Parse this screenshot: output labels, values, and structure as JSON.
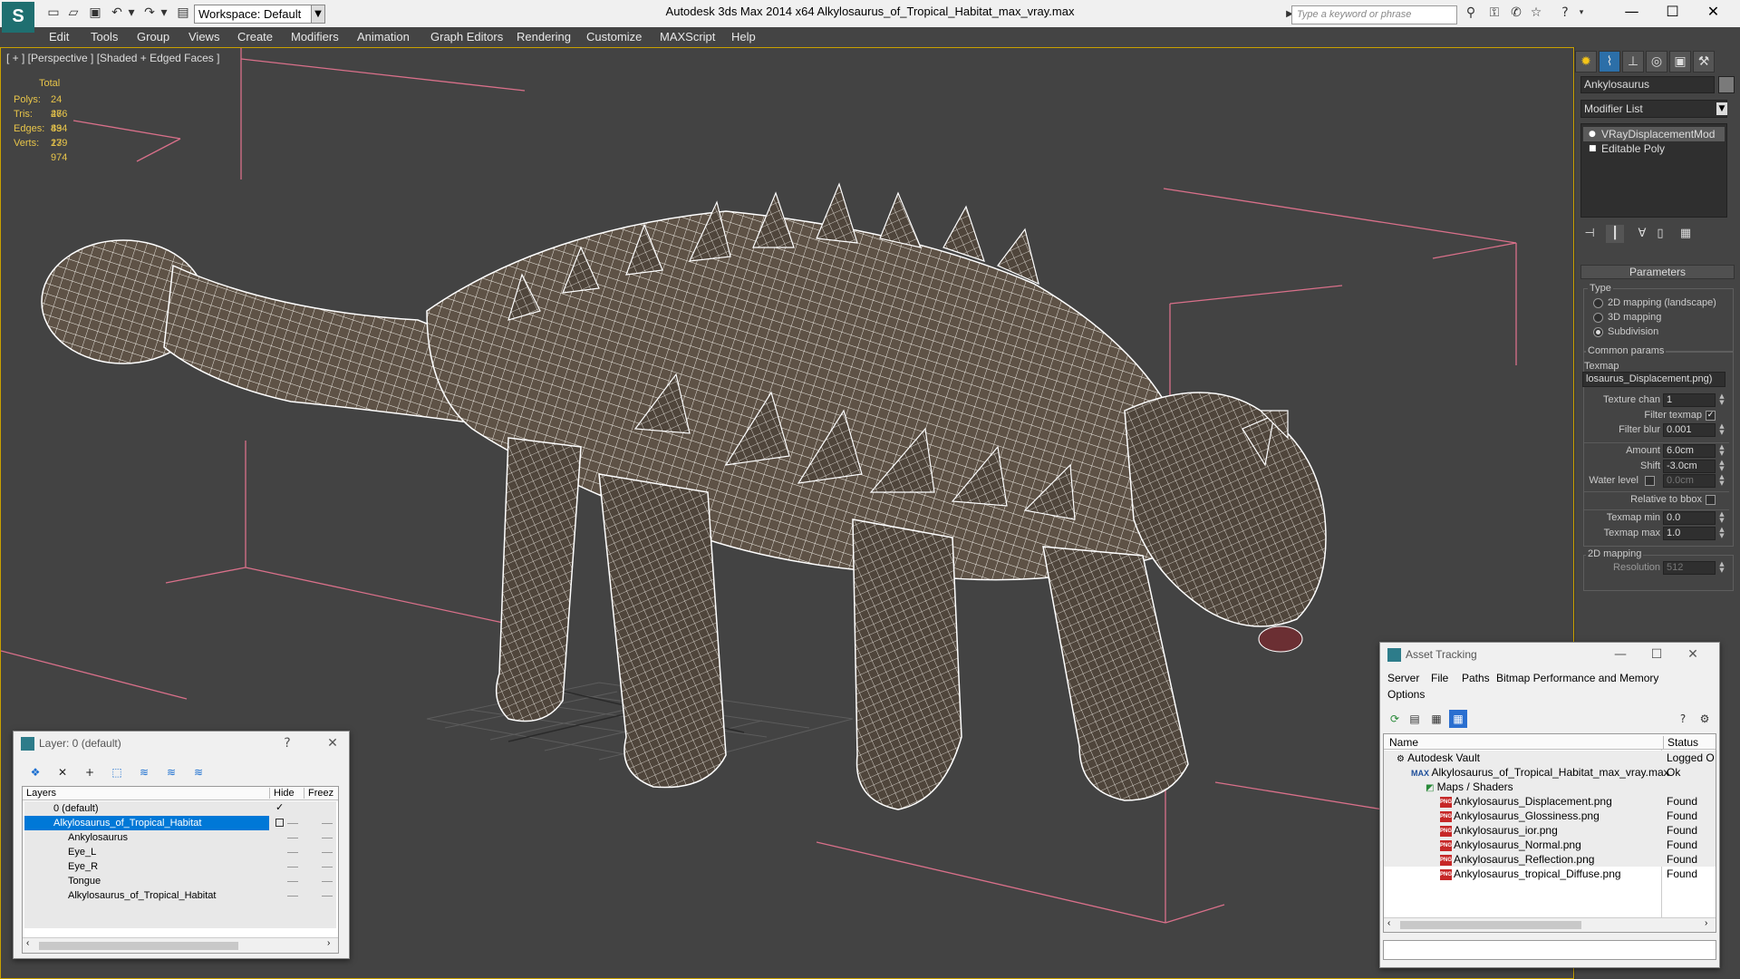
{
  "window": {
    "title": "Autodesk 3ds Max 2014 x64      Alkylosaurus_of_Tropical_Habitat_max_vray.max",
    "workspace": "Workspace: Default",
    "search_placeholder": "Type a keyword or phrase"
  },
  "menu": [
    "Edit",
    "Tools",
    "Group",
    "Views",
    "Create",
    "Modifiers",
    "Animation",
    "Graph Editors",
    "Rendering",
    "Customize",
    "MAXScript",
    "Help"
  ],
  "viewport": {
    "label": "[ + ] [Perspective ] [Shaded + Edged Faces ]",
    "stats_header": "Total",
    "stats": [
      {
        "label": "Polys:",
        "value": "24 266"
      },
      {
        "label": "Tris:",
        "value": "47 834"
      },
      {
        "label": "Edges:",
        "value": "49 179"
      },
      {
        "label": "Verts:",
        "value": "23 974"
      }
    ]
  },
  "command_panel": {
    "object_name": "Ankylosaurus",
    "modifier_list": "Modifier List",
    "stack": [
      "VRayDisplacementMod",
      "Editable Poly"
    ],
    "parameters": {
      "header": "Parameters",
      "type_label": "Type",
      "type_options": [
        "2D mapping (landscape)",
        "3D mapping",
        "Subdivision"
      ],
      "type_selected": 2,
      "common_label": "Common params",
      "texmap_label": "Texmap",
      "texmap_value": "losaurus_Displacement.png)",
      "texture_chan_label": "Texture chan",
      "texture_chan_value": "1",
      "filter_texmap_label": "Filter texmap",
      "filter_blur_label": "Filter blur",
      "filter_blur_value": "0.001",
      "amount_label": "Amount",
      "amount_value": "6.0cm",
      "shift_label": "Shift",
      "shift_value": "-3.0cm",
      "water_label": "Water level",
      "water_value": "0.0cm",
      "relative_label": "Relative to bbox",
      "texmap_min_label": "Texmap min",
      "texmap_min_value": "0.0",
      "texmap_max_label": "Texmap max",
      "texmap_max_value": "1.0",
      "mapping2d_label": "2D mapping",
      "resolution_label": "Resolution",
      "resolution_value": "512"
    }
  },
  "layer_window": {
    "title": "Layer: 0 (default)",
    "help": "?",
    "columns": [
      "Layers",
      "Hide",
      "Freez"
    ],
    "rows": [
      {
        "name": "0 (default)",
        "indent": 1
      },
      {
        "name": "Alkylosaurus_of_Tropical_Habitat",
        "indent": 1
      },
      {
        "name": "Ankylosaurus",
        "indent": 2
      },
      {
        "name": "Eye_L",
        "indent": 2
      },
      {
        "name": "Eye_R",
        "indent": 2
      },
      {
        "name": "Tongue",
        "indent": 2
      },
      {
        "name": "Alkylosaurus_of_Tropical_Habitat",
        "indent": 2
      }
    ]
  },
  "asset_window": {
    "title": "Asset Tracking",
    "menu": [
      "Server",
      "File",
      "Paths",
      "Bitmap Performance and Memory",
      "Options"
    ],
    "columns": [
      "Name",
      "Status"
    ],
    "rows": [
      {
        "name": "Autodesk Vault",
        "status": "Logged O",
        "indent": 0
      },
      {
        "name": "Alkylosaurus_of_Tropical_Habitat_max_vray.max",
        "status": "Ok",
        "indent": 1
      },
      {
        "name": "Maps / Shaders",
        "status": "",
        "indent": 2
      },
      {
        "name": "Ankylosaurus_Displacement.png",
        "status": "Found",
        "indent": 3
      },
      {
        "name": "Ankylosaurus_Glossiness.png",
        "status": "Found",
        "indent": 3
      },
      {
        "name": "Ankylosaurus_ior.png",
        "status": "Found",
        "indent": 3
      },
      {
        "name": "Ankylosaurus_Normal.png",
        "status": "Found",
        "indent": 3
      },
      {
        "name": "Ankylosaurus_Reflection.png",
        "status": "Found",
        "indent": 3
      },
      {
        "name": "Ankylosaurus_tropical_Diffuse.png",
        "status": "Found",
        "indent": 3
      }
    ]
  },
  "colors": {
    "viewport_bg": "#434343",
    "stats_text": "#e8c54a",
    "bbox_lines": "#d9708a",
    "selection": "#0078d7",
    "model_body": "#5e5246"
  }
}
